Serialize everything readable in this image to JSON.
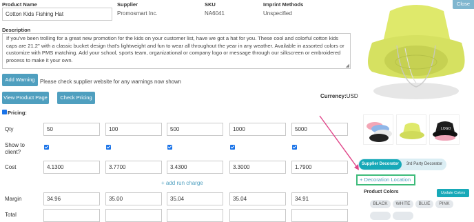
{
  "header": {
    "product_name_label": "Product Name",
    "product_name_value": "Cotton Kids Fishing Hat",
    "supplier_label": "Supplier",
    "supplier_value": "Promosmart Inc.",
    "sku_label": "SKU",
    "sku_value": "NA6041",
    "imprint_label": "Imprint Methods",
    "imprint_value": "Unspecified"
  },
  "description": {
    "label": "Description",
    "text": "If you've been trolling for a great new promotion for the kids on your customer list, have we got a hat for you. These cool and colorful cotton kids caps are 21.2\" with a classic bucket design that's lightweight and fun to wear all throughout the year in any weather. Available in assorted colors or customize with PMS matching. Add your school, sports team, organizational or company logo or message through our silkscreen or embroidered process to make it your own."
  },
  "warning": {
    "button": "Add Warning",
    "text": "Please check supplier website for any warnings now shown"
  },
  "actions": {
    "view_product": "View Product Page",
    "check_pricing": "Check Pricing",
    "currency_label": "Currency:",
    "currency_value": "USD"
  },
  "pricing": {
    "label": "Pricing:",
    "qty_label": "Qty",
    "show_label_1": "Show to",
    "show_label_2": "client?",
    "cost_label": "Cost",
    "add_run_charge": "+ add run charge",
    "margin_label": "Margin",
    "total_label": "Total",
    "columns": [
      {
        "qty": "50",
        "show": true,
        "cost": "4.1300",
        "margin": "34.96"
      },
      {
        "qty": "100",
        "show": true,
        "cost": "3.7700",
        "margin": "35.00"
      },
      {
        "qty": "500",
        "show": true,
        "cost": "3.4300",
        "margin": "35.04"
      },
      {
        "qty": "1000",
        "show": true,
        "cost": "3.3000",
        "margin": "35.04"
      },
      {
        "qty": "5000",
        "show": true,
        "cost": "1.7900",
        "margin": "34.91"
      }
    ]
  },
  "right_panel": {
    "close": "Close",
    "supplier_decorator": "Supplier Decorator",
    "third_party_decorator": "3rd Party Decorator",
    "decoration_location": "+ Decoration Location",
    "product_colors_label": "Product Colors",
    "update_colors": "Update Colors",
    "colors": [
      "BLACK",
      "WHITE",
      "BLUE",
      "PINK"
    ],
    "thumb_logo_text": "LOGO"
  },
  "colors": {
    "accent": "#4f9fbf",
    "teal": "#17a9b8",
    "hat": "#dfe96b",
    "arrow": "#e0478a",
    "highlight_border": "#3dbb7a"
  }
}
